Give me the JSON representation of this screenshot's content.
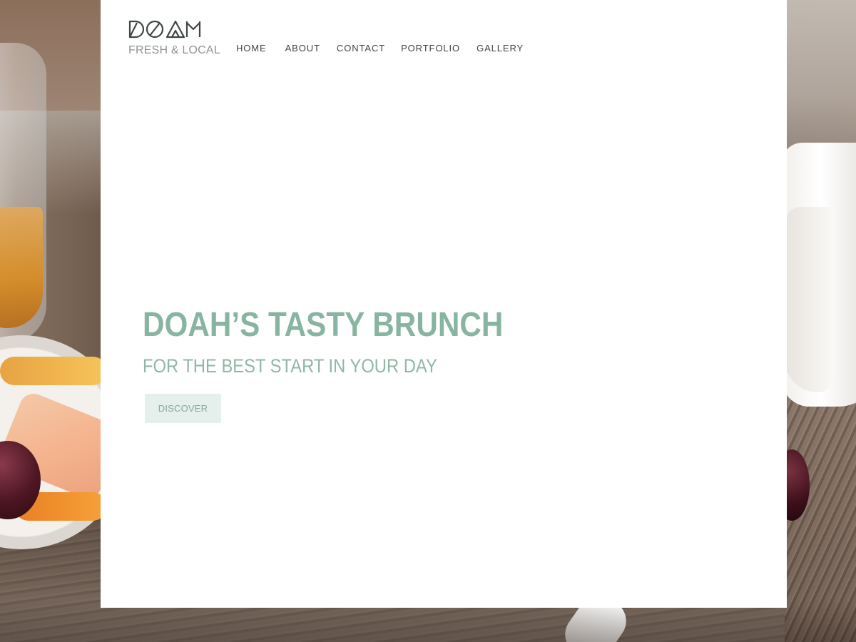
{
  "brand": {
    "logo_icon": "doah-wordmark",
    "name": "DOAH",
    "tagline": "FRESH & LOCAL"
  },
  "nav": {
    "items": [
      {
        "label": "HOME"
      },
      {
        "label": "ABOUT"
      },
      {
        "label": "CONTACT"
      },
      {
        "label": "PORTFOLIO"
      },
      {
        "label": "GALLERY"
      }
    ]
  },
  "hero": {
    "title": "DOAH’S TASTY BRUNCH",
    "subtitle": "FOR THE BEST START IN YOUR DAY",
    "cta_label": "DISCOVER"
  },
  "colors": {
    "accent": "#88b4a2",
    "nav_text": "#3f4545",
    "tagline": "#8f9393",
    "button_bg": "#e5efeb",
    "button_text": "#86a99b",
    "panel_bg": "#ffffff"
  }
}
